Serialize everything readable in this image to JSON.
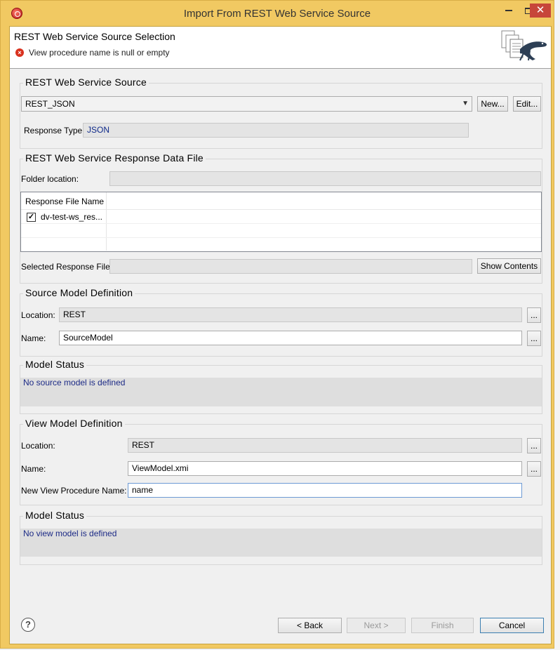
{
  "window": {
    "title": "Import From REST Web Service Source"
  },
  "banner": {
    "title": "REST Web Service Source Selection",
    "message": "View procedure name is null or empty"
  },
  "source_group": {
    "title": "REST Web Service Source",
    "source_value": "REST_JSON",
    "new_label": "New...",
    "edit_label": "Edit...",
    "response_type_label": "Response Type",
    "response_type_value": "JSON"
  },
  "response_group": {
    "title": "REST Web Service Response Data File",
    "folder_label": "Folder location:",
    "folder_value": "",
    "table_header": "Response File Name",
    "rows": [
      {
        "checked": true,
        "name": "dv-test-ws_res..."
      }
    ],
    "selected_label": "Selected Response File:",
    "selected_value": "",
    "show_contents_label": "Show Contents"
  },
  "source_model": {
    "title": "Source Model Definition",
    "location_label": "Location:",
    "location_value": "REST",
    "name_label": "Name:",
    "name_value": "SourceModel",
    "browse_label": "..."
  },
  "source_status": {
    "title": "Model Status",
    "message": "No source model is defined"
  },
  "view_model": {
    "title": "View Model Definition",
    "location_label": "Location:",
    "location_value": "REST",
    "name_label": "Name:",
    "name_value": "ViewModel.xmi",
    "proc_label": "New View Procedure Name:",
    "proc_value": "name",
    "browse_label": "..."
  },
  "view_status": {
    "title": "Model Status",
    "message": "No view model is defined"
  },
  "footer": {
    "back_label": "< Back",
    "next_label": "Next >",
    "finish_label": "Finish",
    "cancel_label": "Cancel"
  },
  "icons": {
    "app": "eclipse-icon",
    "error": "error-icon",
    "help": "help-icon",
    "banner": "documents-lizard-icon"
  },
  "colors": {
    "title_bar": "#f1c962",
    "close_button": "#c7463a",
    "status_text": "#1c2a86",
    "error": "#d9321f"
  }
}
